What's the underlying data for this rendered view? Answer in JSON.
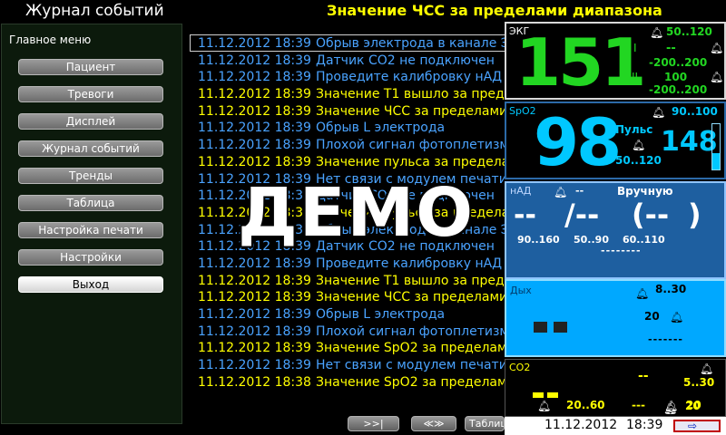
{
  "header": {
    "screen_title": "Журнал событий",
    "alarm_message": "Значение ЧСС за пределами диапазона"
  },
  "menu": {
    "title": "Главное меню",
    "items": [
      {
        "label": "Пациент"
      },
      {
        "label": "Тревоги"
      },
      {
        "label": "Дисплей"
      },
      {
        "label": "Журнал событий"
      },
      {
        "label": "Тренды"
      },
      {
        "label": "Таблица"
      },
      {
        "label": "Настройка печати"
      },
      {
        "label": "Настройки"
      },
      {
        "label": "Выход",
        "active": true
      }
    ]
  },
  "event_log": {
    "rows": [
      {
        "date": "11.12.2012 18:39",
        "text": "Обрыв электрода в канале ЭКГ",
        "color": "blue"
      },
      {
        "date": "11.12.2012 18:39",
        "text": "Датчик CO2 не подключен",
        "color": "blue"
      },
      {
        "date": "11.12.2012 18:39",
        "text": "Проведите калибровку нАД",
        "color": "blue"
      },
      {
        "date": "11.12.2012 18:39",
        "text": "Значение T1 вышло за пределы",
        "color": "yellow"
      },
      {
        "date": "11.12.2012 18:39",
        "text": "Значение ЧСС за пределами",
        "color": "yellow"
      },
      {
        "date": "11.12.2012 18:39",
        "text": "Обрыв L электрода",
        "color": "blue"
      },
      {
        "date": "11.12.2012 18:39",
        "text": "Плохой сигнал фотоплетизмограммы",
        "color": "blue"
      },
      {
        "date": "11.12.2012 18:39",
        "text": "Значение пульса за пределами",
        "color": "yellow"
      },
      {
        "date": "11.12.2012 18:39",
        "text": "Нет связи с модулем печати",
        "color": "blue"
      },
      {
        "date": "11.12.2012 18:39",
        "text": "Датчик CO2 не подключен",
        "color": "blue"
      },
      {
        "date": "11.12.2012 18:39",
        "text": "Значение пульса за пределами",
        "color": "yellow"
      },
      {
        "date": "11.12.2012 18:39",
        "text": "Обрыв электрода в канале ЭКГ",
        "color": "blue"
      },
      {
        "date": "11.12.2012 18:39",
        "text": "Датчик CO2 не подключен",
        "color": "blue"
      },
      {
        "date": "11.12.2012 18:39",
        "text": "Проведите калибровку нАД",
        "color": "blue"
      },
      {
        "date": "11.12.2012 18:39",
        "text": "Значение T1 вышло за пределы",
        "color": "yellow"
      },
      {
        "date": "11.12.2012 18:39",
        "text": "Значение ЧСС за пределами",
        "color": "yellow"
      },
      {
        "date": "11.12.2012 18:39",
        "text": "Обрыв L электрода",
        "color": "blue"
      },
      {
        "date": "11.12.2012 18:39",
        "text": "Плохой сигнал фотоплетизмограммы",
        "color": "blue"
      },
      {
        "date": "11.12.2012 18:39",
        "text": "Значение SpO2 за пределами",
        "color": "yellow"
      },
      {
        "date": "11.12.2012 18:39",
        "text": "Нет связи с модулем печати",
        "color": "blue"
      },
      {
        "date": "11.12.2012 18:38",
        "text": "Значение SpO2 за пределами",
        "color": "yellow"
      }
    ]
  },
  "watermark": "ДЕМО",
  "nav": {
    "next_page": ">>|",
    "scroll": "≪≫",
    "table": "Таблица"
  },
  "ecg": {
    "label": "ЭКГ",
    "hr": "151",
    "hr_range": "50..120",
    "lead_i": "I",
    "lead_ii": "II",
    "st1_value": "--",
    "st1_range": "-200..200",
    "st2_value": "100",
    "st2_range": "-200..200"
  },
  "spo2": {
    "label": "SpO2",
    "value": "98",
    "range": "90..100",
    "pulse_label": "Пульс",
    "pulse_value": "148",
    "pulse_range": "50..120",
    "signal_level": 0.35
  },
  "nibp": {
    "label": "нАД",
    "interval_value": "--",
    "mode": "Вручную",
    "systolic": "--",
    "diastolic": "/--",
    "mean": "(--",
    "mean_close": ")",
    "sys_range": "90..160",
    "dia_range": "50..90",
    "mean_range": "60..110",
    "last_time": "--------"
  },
  "resp": {
    "label": "Дых",
    "range": "8..30",
    "apnea_value": "20",
    "time": "-------"
  },
  "co2": {
    "label": "CO2",
    "etco2": "--",
    "etco2_range": "5..30",
    "fico2_limit": "20",
    "rr_range": "20..60",
    "rr_value": "---",
    "rr_limit": "20"
  },
  "status": {
    "date": "11.12.2012",
    "time": "18:39"
  },
  "colors": {
    "ecg_green": "#22d622",
    "spo2_cyan": "#00c8ff",
    "alarm_yellow": "#ffff00",
    "log_blue": "#4aa3ff"
  }
}
